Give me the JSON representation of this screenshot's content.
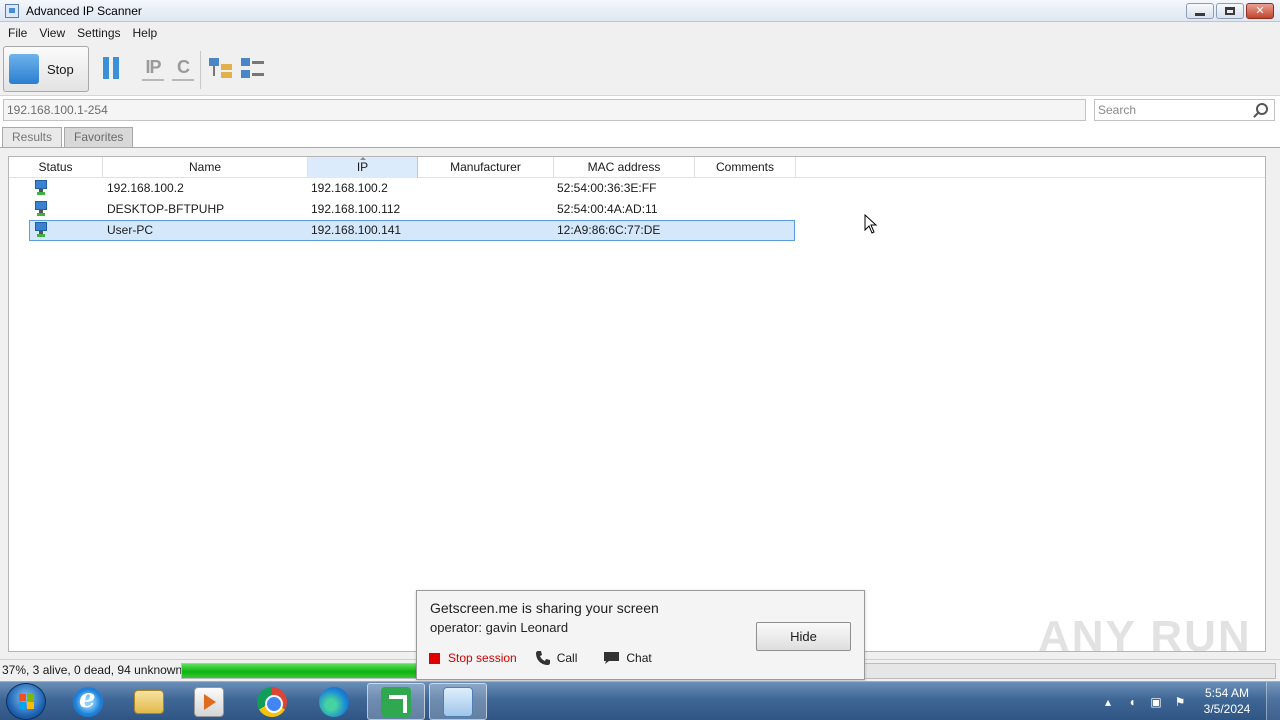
{
  "window": {
    "title": "Advanced IP Scanner"
  },
  "menu": [
    "File",
    "View",
    "Settings",
    "Help"
  ],
  "toolbar": {
    "stop_label": "Stop"
  },
  "scan_range": "192.168.100.1-254",
  "search": {
    "placeholder": "Search"
  },
  "tabs": [
    "Results",
    "Favorites"
  ],
  "table": {
    "columns": [
      "Status",
      "Name",
      "IP",
      "Manufacturer",
      "MAC address",
      "Comments"
    ],
    "sorted_column": "IP",
    "rows": [
      {
        "name": "192.168.100.2",
        "ip": "192.168.100.2",
        "manufacturer": "",
        "mac": "52:54:00:36:3E:FF",
        "comments": "",
        "selected": false
      },
      {
        "name": "DESKTOP-BFTPUHP",
        "ip": "192.168.100.112",
        "manufacturer": "",
        "mac": "52:54:00:4A:AD:11",
        "comments": "",
        "selected": false
      },
      {
        "name": "User-PC",
        "ip": "192.168.100.141",
        "manufacturer": "",
        "mac": "12:A9:86:6C:77:DE",
        "comments": "",
        "selected": true
      }
    ]
  },
  "status": {
    "text": "37%, 3 alive, 0 dead, 94 unknown",
    "progress": 0.37
  },
  "popup": {
    "title": "Getscreen.me is sharing your screen",
    "operator": "operator: gavin Leonard",
    "stop_session": "Stop session",
    "call": "Call",
    "chat": "Chat",
    "hide": "Hide"
  },
  "watermark": "ANY RUN",
  "taskbar": {
    "apps": [
      "internet-explorer",
      "file-explorer",
      "media-player",
      "chrome",
      "edge",
      "getscreen",
      "advanced-ip-scanner"
    ],
    "active_app": "advanced-ip-scanner",
    "time": "5:54 AM",
    "date": "3/5/2024"
  },
  "colors": {
    "accent": "#3d8fd8",
    "progress": "#0fb30f",
    "selection": "#d5e8fb",
    "stop_session": "#d10000"
  }
}
